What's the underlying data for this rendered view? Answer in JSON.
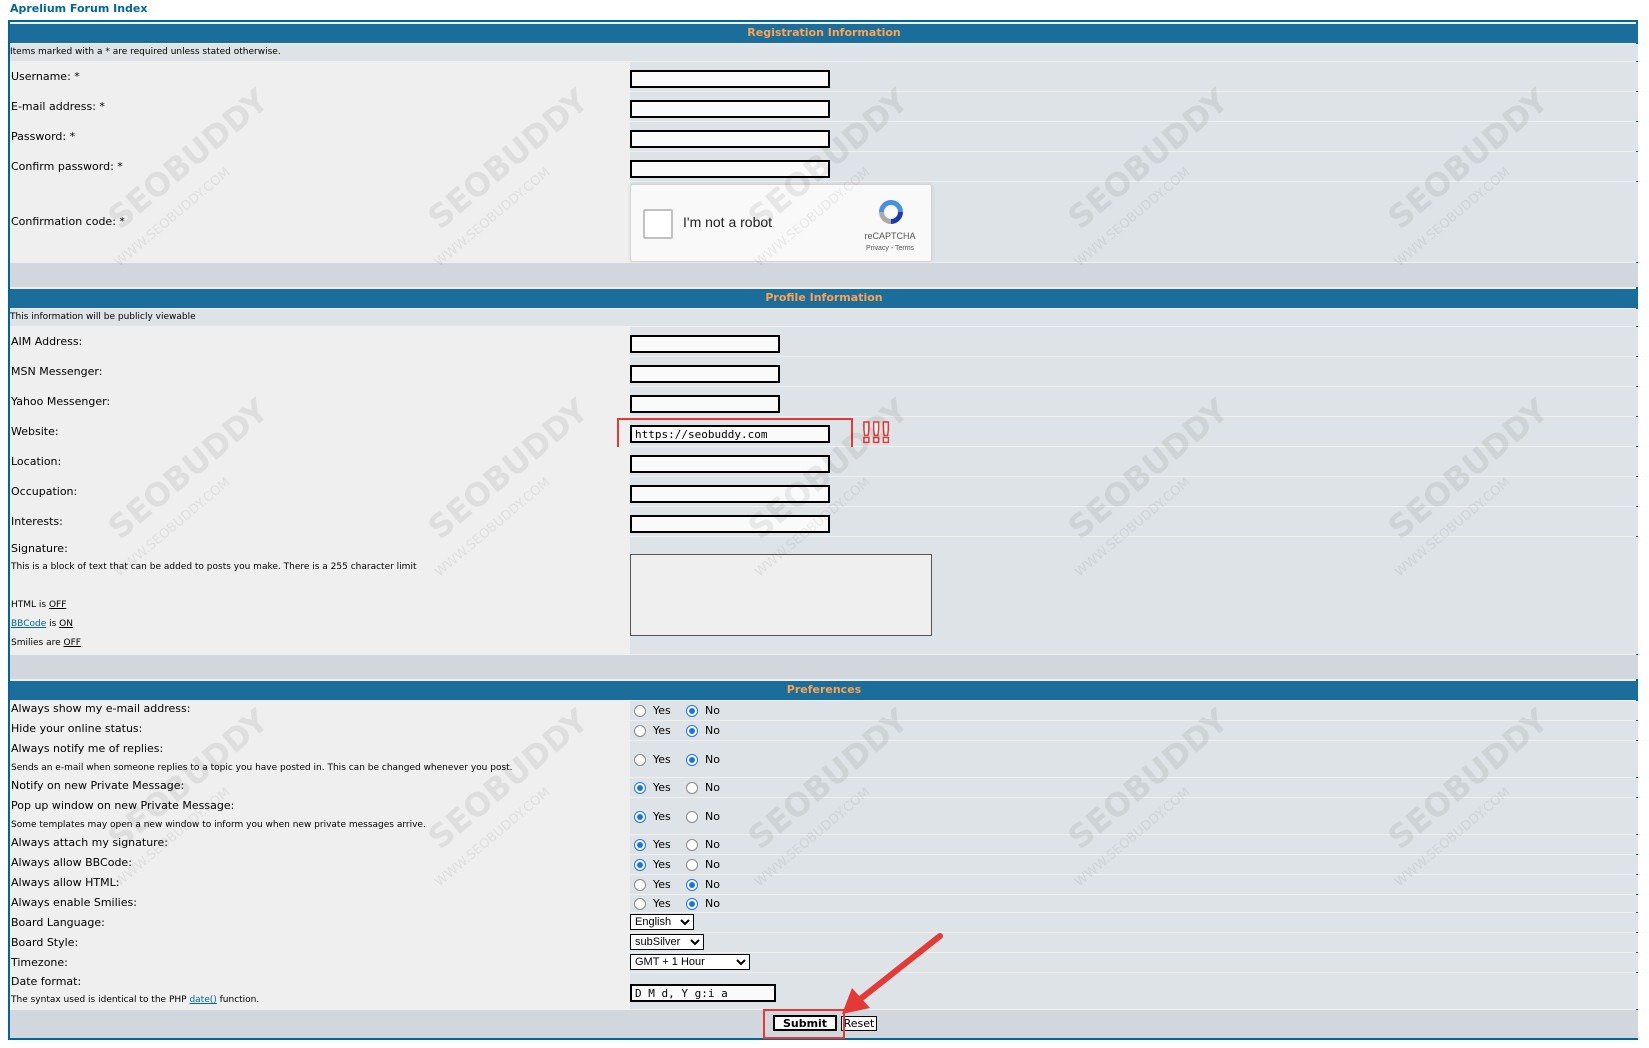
{
  "breadcrumb": "Aprelium Forum Index",
  "registration": {
    "header": "Registration Information",
    "note": "Items marked with a * are required unless stated otherwise.",
    "username_label": "Username: *",
    "email_label": "E-mail address: *",
    "password_label": "Password: *",
    "confirm_password_label": "Confirm password: *",
    "confirmation_code_label": "Confirmation code: *",
    "captcha": {
      "text": "I'm not a robot",
      "brand": "reCAPTCHA",
      "links": "Privacy - Terms"
    }
  },
  "profile": {
    "header": "Profile Information",
    "note": "This information will be publicly viewable",
    "aim_label": "AIM Address:",
    "msn_label": "MSN Messenger:",
    "yahoo_label": "Yahoo Messenger:",
    "website_label": "Website:",
    "website_value": "https://seobuddy.com",
    "location_label": "Location:",
    "occupation_label": "Occupation:",
    "interests_label": "Interests:",
    "signature_label": "Signature:",
    "signature_help": "This is a block of text that can be added to posts you make. There is a 255 character limit",
    "html_prefix": "HTML is ",
    "html_state": "OFF",
    "bbcode_link": "BBCode",
    "bbcode_mid": " is ",
    "bbcode_state": "ON",
    "smilies_prefix": "Smilies are ",
    "smilies_state": "OFF",
    "annotation": "!!!"
  },
  "preferences": {
    "header": "Preferences",
    "yes": "Yes",
    "no": "No",
    "items": [
      {
        "label": "Always show my e-mail address:",
        "value": "No"
      },
      {
        "label": "Hide your online status:",
        "value": "No"
      },
      {
        "label": "Always notify me of replies:",
        "help": "Sends an e-mail when someone replies to a topic you have posted in. This can be changed whenever you post.",
        "value": "No"
      },
      {
        "label": "Notify on new Private Message:",
        "value": "Yes"
      },
      {
        "label": "Pop up window on new Private Message:",
        "help": "Some templates may open a new window to inform you when new private messages arrive.",
        "value": "Yes"
      },
      {
        "label": "Always attach my signature:",
        "value": "Yes"
      },
      {
        "label": "Always allow BBCode:",
        "value": "Yes"
      },
      {
        "label": "Always allow HTML:",
        "value": "No"
      },
      {
        "label": "Always enable Smilies:",
        "value": "No"
      }
    ],
    "language_label": "Board Language:",
    "language_value": "English",
    "style_label": "Board Style:",
    "style_value": "subSilver",
    "timezone_label": "Timezone:",
    "timezone_value": "GMT + 1 Hour",
    "date_format_label": "Date format:",
    "date_format_help_prefix": "The syntax used is identical to the PHP ",
    "date_format_help_link": "date()",
    "date_format_help_suffix": " function.",
    "date_format_value": "D M d, Y g:i a"
  },
  "buttons": {
    "submit": "Submit",
    "reset": "Reset"
  },
  "watermark": {
    "brand": "SEOBUDDY",
    "url": "WWW.SEOBUDDY.COM"
  },
  "colors": {
    "header_bg": "#1b6e9c",
    "header_text": "#ffa34f",
    "highlight": "#e53935"
  }
}
